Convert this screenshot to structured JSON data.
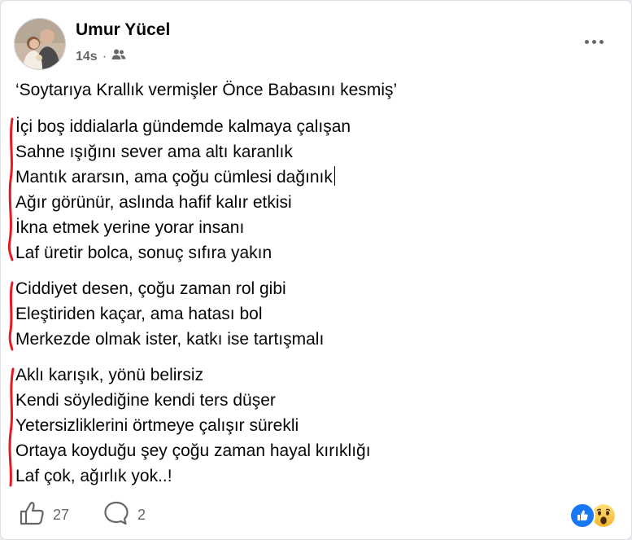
{
  "post": {
    "author": "Umur Yücel",
    "time": "14s",
    "separator": "·",
    "audience_icon": "friends-icon",
    "title": "‘Soytarıya Krallık vermişler Önce Babasını kesmiş’"
  },
  "stanzas": [
    {
      "lines": [
        "İçi boş iddialarla gündemde kalmaya çalışan",
        "Sahne ışığını sever ama altı karanlık",
        "Mantık ararsın, ama çoğu cümlesi dağınık",
        "Ağır görünür, aslında hafif kalır etkisi",
        "İkna etmek yerine yorar insanı",
        "Laf üretir bolca, sonuç sıfıra yakın"
      ]
    },
    {
      "lines": [
        "Ciddiyet desen, çoğu zaman rol gibi",
        "Eleştiriden kaçar, ama hatası bol",
        "Merkezde olmak ister, katkı ise tartışmalı"
      ]
    },
    {
      "lines": [
        "Aklı karışık, yönü belirsiz",
        "Kendi söylediğine kendi ters düşer",
        "Yetersizliklerini örtmeye çalışır sürekli",
        "Ortaya koyduğu şey çoğu zaman hayal kırıklığı",
        "Laf çok, ağırlık yok..!"
      ]
    }
  ],
  "footer": {
    "like_count": "27",
    "comment_count": "2",
    "reactions": [
      "like-reaction-icon",
      "wow-reaction-icon"
    ]
  },
  "colors": {
    "accent_blue": "#1877f2",
    "annotation_red": "#e41b23",
    "secondary_text": "#65676b"
  }
}
